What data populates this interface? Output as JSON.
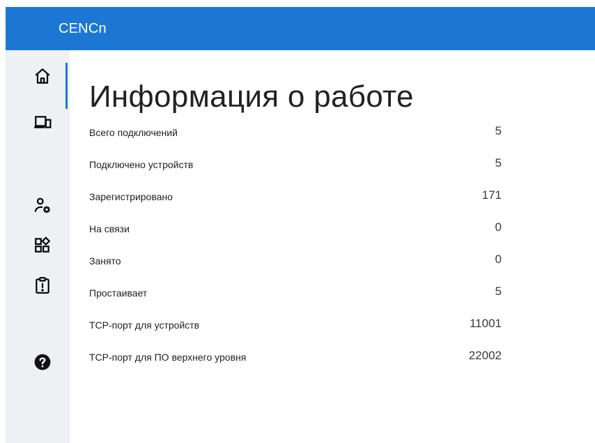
{
  "app": {
    "title": "CENCn"
  },
  "sidebar": {
    "items": [
      {
        "icon": "home-icon",
        "active": true
      },
      {
        "icon": "devices-icon",
        "active": false
      },
      {
        "icon": "user-settings-icon",
        "active": false
      },
      {
        "icon": "apps-icon",
        "active": false
      },
      {
        "icon": "clipboard-alert-icon",
        "active": false
      },
      {
        "icon": "help-icon",
        "active": false
      }
    ],
    "accent": "#1c77d4",
    "background": "#eef0f3"
  },
  "main": {
    "title": "Информация о работе",
    "stats": [
      {
        "label": "Всего подключений",
        "value": "5"
      },
      {
        "label": "Подключено устройств",
        "value": "5"
      },
      {
        "label": "Зарегистрировано",
        "value": "171"
      },
      {
        "label": "На связи",
        "value": "0"
      },
      {
        "label": "Занято",
        "value": "0"
      },
      {
        "label": "Простаивает",
        "value": "5"
      },
      {
        "label": "TCP-порт для устройств",
        "value": "11001"
      },
      {
        "label": "TCP-порт для ПО верхнего уровня",
        "value": "22002"
      }
    ]
  },
  "colors": {
    "header": "#1c77d4"
  }
}
